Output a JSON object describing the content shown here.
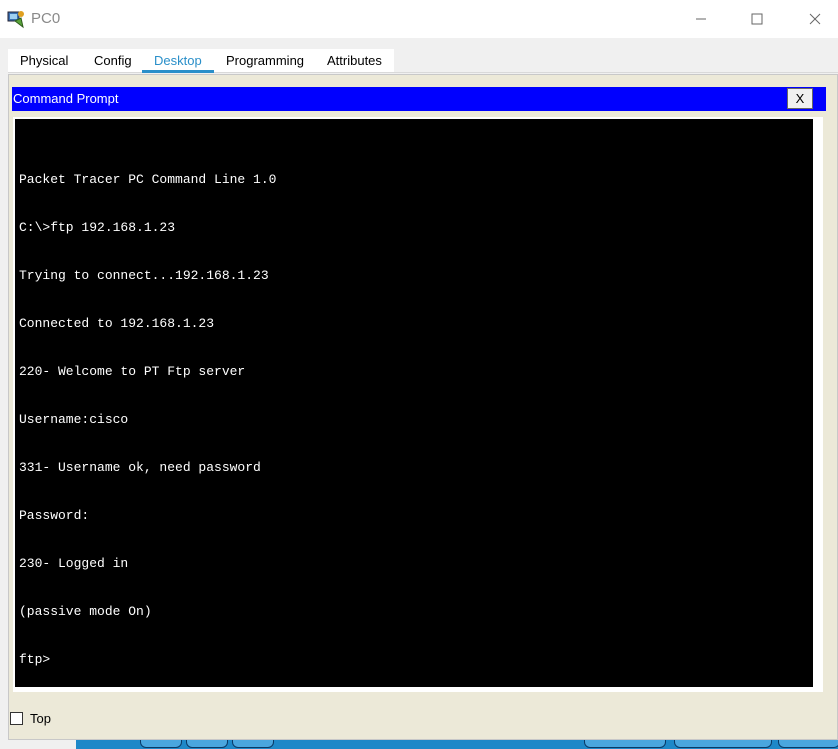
{
  "window": {
    "title": "PC0",
    "icon": "packet-tracer-pc-icon"
  },
  "tabs": [
    {
      "label": "Physical",
      "active": false
    },
    {
      "label": "Config",
      "active": false
    },
    {
      "label": "Desktop",
      "active": true
    },
    {
      "label": "Programming",
      "active": false
    },
    {
      "label": "Attributes",
      "active": false
    }
  ],
  "command_prompt": {
    "title": "Command Prompt",
    "close_label": "X",
    "lines": [
      "Packet Tracer PC Command Line 1.0",
      "C:\\>ftp 192.168.1.23",
      "Trying to connect...192.168.1.23",
      "Connected to 192.168.1.23",
      "220- Welcome to PT Ftp server",
      "Username:cisco",
      "331- Username ok, need password",
      "Password:",
      "230- Logged in",
      "(passive mode On)",
      "ftp>"
    ]
  },
  "bottom": {
    "top_label": "Top",
    "top_checked": false
  },
  "colors": {
    "header_blue": "#0000ff",
    "active_tab": "#2a8fc9",
    "terminal_bg": "#000000",
    "terminal_fg": "#ffffff"
  }
}
